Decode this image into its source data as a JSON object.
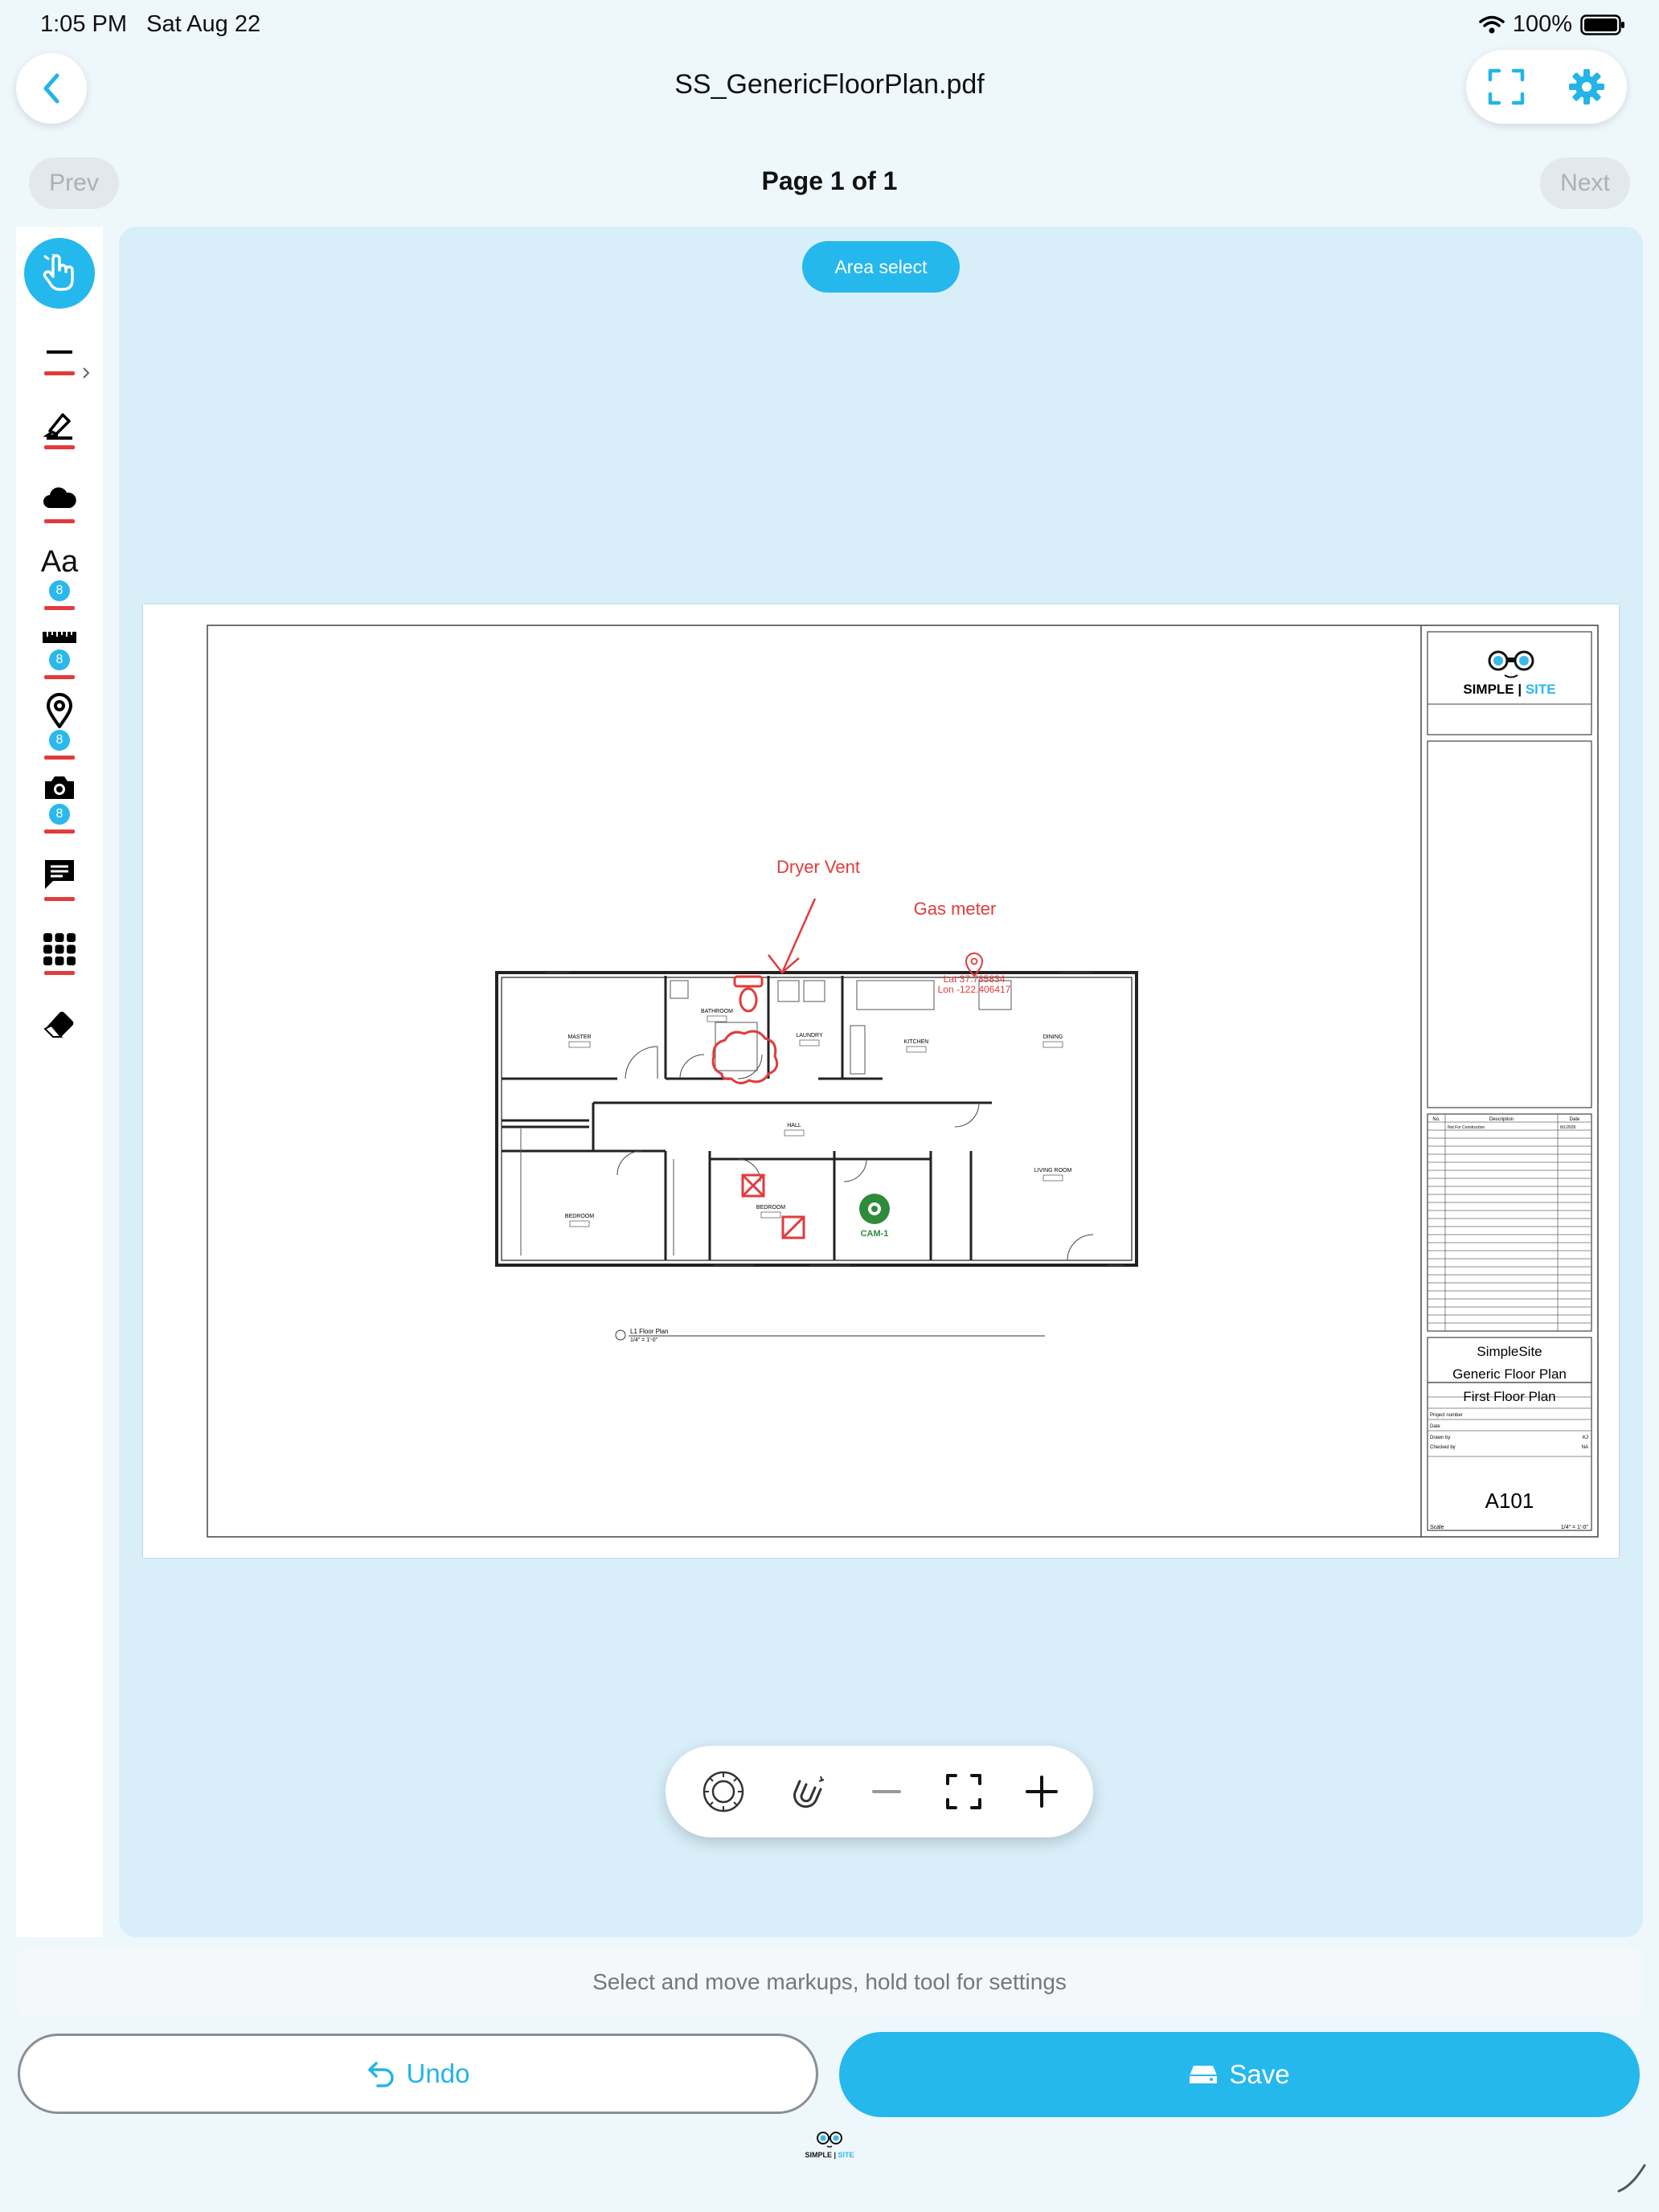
{
  "status_bar": {
    "time": "1:05 PM",
    "date": "Sat Aug 22",
    "battery": "100%"
  },
  "header": {
    "title": "SS_GenericFloorPlan.pdf"
  },
  "pager": {
    "prev_label": "Prev",
    "next_label": "Next",
    "page_indicator": "Page 1 of 1"
  },
  "toolbar": {
    "badges": [
      "8",
      "8",
      "8",
      "8"
    ],
    "text_tool_label": "Aa"
  },
  "canvas": {
    "area_select_label": "Area select"
  },
  "markups": {
    "dryer_vent": "Dryer Vent",
    "gas_meter": "Gas meter",
    "lat": "Lat 37.785834",
    "lon": "Lon -122.406417",
    "camera": "CAM-1"
  },
  "plan": {
    "rooms": {
      "master": "MASTER",
      "bathroom": "BATHROOM",
      "laundry": "LAUNDRY",
      "kitchen": "KITCHEN",
      "dining": "DINING",
      "hall": "HALL",
      "bedroom": "BEDROOM",
      "bedroom2": "BEDROOM",
      "living": "LIVING ROOM"
    },
    "caption_title": "L1 Floor Plan",
    "caption_scale": "1/4\" = 1'-0\""
  },
  "title_block": {
    "logo_simple": "SIMPLE",
    "logo_sep": " | ",
    "logo_site": "SITE",
    "rev_no": "No.",
    "rev_desc": "Description",
    "rev_date": "Date",
    "rev_row_desc": "Not For Construction",
    "rev_row_date": "8/1/2026",
    "project_line1": "SimpleSite",
    "project_line2": "Generic Floor Plan",
    "project_line3": "First Floor Plan",
    "project_number_label": "Project number",
    "date_label": "Date",
    "drawn_by_label": "Drawn by",
    "drawn_by": "KJ",
    "checked_by_label": "Checked by",
    "checked_by": "NA",
    "sheet_number": "A101",
    "scale_label": "Scale",
    "scale": "1/4\" = 1'-0\""
  },
  "hint": "Select and move markups, hold tool for settings",
  "actions": {
    "undo_label": "Undo",
    "save_label": "Save"
  },
  "footer": {
    "logo_simple": "SIMPLE",
    "logo_sep": " | ",
    "logo_site": "SITE"
  },
  "colors": {
    "accent": "#25b8ec",
    "markup_red": "#e23b3b",
    "camera_green": "#2e8b3a"
  }
}
